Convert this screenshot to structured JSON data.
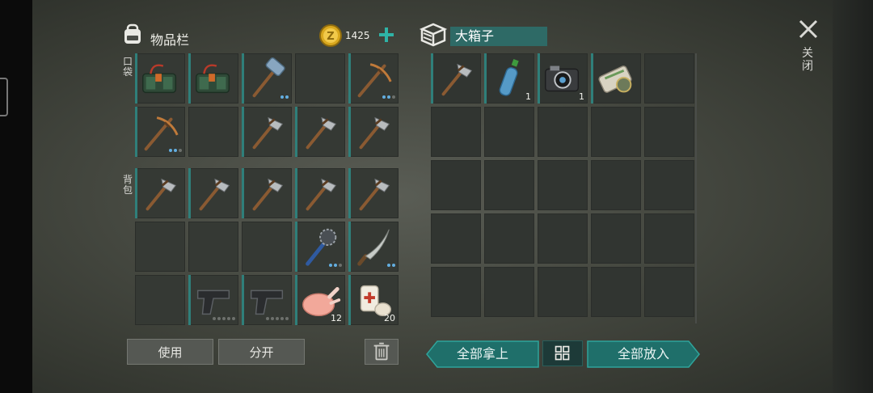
{
  "inventory": {
    "title": "物品栏",
    "coins": "1425",
    "pocket_label": "口袋",
    "backpack_label": "背包",
    "use_label": "使用",
    "split_label": "分开",
    "pocket_slots": [
      {
        "item": "dynamite-bundle-icon",
        "qty": null
      },
      {
        "item": "dynamite-bundle-icon",
        "qty": null
      },
      {
        "item": "sledgehammer-icon",
        "qty": null,
        "durability_dots": 2
      },
      {
        "item": null
      },
      {
        "item": "pickaxe-icon",
        "qty": null,
        "durability_dots": 3
      },
      {
        "item": "pickaxe-icon",
        "qty": null,
        "durability_dots": 3
      },
      {
        "item": null
      },
      {
        "item": "stone-hatchet-icon",
        "qty": null
      },
      {
        "item": "stone-hatchet-icon",
        "qty": null
      },
      {
        "item": "stone-hatchet-icon",
        "qty": null
      }
    ],
    "backpack_slots": [
      {
        "item": "stone-hatchet-icon"
      },
      {
        "item": "stone-hatchet-icon"
      },
      {
        "item": "stone-hatchet-icon"
      },
      {
        "item": "stone-hatchet-icon"
      },
      {
        "item": "stone-hatchet-icon"
      },
      {
        "item": null
      },
      {
        "item": null
      },
      {
        "item": null
      },
      {
        "item": "spiked-club-icon",
        "durability_dots": 3
      },
      {
        "item": "machete-icon",
        "durability_dots": 2
      },
      {
        "item": null
      },
      {
        "item": "pistol-icon",
        "durability_dots": 5
      },
      {
        "item": "pistol-icon",
        "durability_dots": 5
      },
      {
        "item": "raw-chicken-icon",
        "qty": "12"
      },
      {
        "item": "bandage-icon",
        "qty": "20"
      }
    ]
  },
  "container": {
    "name": "大箱子",
    "take_all_label": "全部拿上",
    "put_all_label": "全部放入",
    "slots": [
      {
        "item": "stone-hatchet-icon"
      },
      {
        "item": "water-bottle-icon",
        "qty": "1"
      },
      {
        "item": "camera-icon",
        "qty": "1"
      },
      {
        "item": "scroll-map-icon"
      }
    ]
  },
  "close_label": "关闭",
  "colors": {
    "accent": "#2e8f8a",
    "highlight": "#2e6a66"
  }
}
